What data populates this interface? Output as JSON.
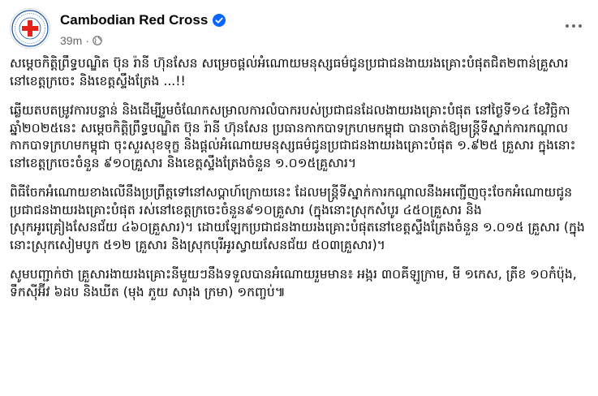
{
  "post": {
    "author": "Cambodian Red Cross",
    "time": "39m",
    "separator": "·",
    "paragraphs": [
      "សម្ដេចកិត្តិព្រឹទ្ធបណ្ឌិត ប៊ុន រ៉ានី ហ៊ុនសែន សម្រេចផ្ដល់អំណោយមនុស្សធម៌ជូនប្រជាជនងាយរងគ្រោះបំផុតជិត២ពាន់គ្រួសារ នៅខេត្តក្រចេះ និងខេត្តស្ទឹងត្រែង ...!!",
      "ឆ្លើយតបតម្រូវការបន្ទាន់ និងដើម្បីរួមចំណែកសម្រាលការលំបាករបស់ប្រជាជនដែលងាយរងគ្រោះបំផុត នៅថ្ងៃទី១៤ ខែវិច្ឆិកា ឆ្នាំ២០២៥នេះ សម្ដេចកិត្តិព្រឹទ្ធបណ្ឌិត ប៊ុន រ៉ានី ហ៊ុនសែន ប្រធានកាកបាទក្រហមកម្ពុជា បានចាត់ឱ្យមន្ត្រីទីស្នាក់ការកណ្ដាលកាកបាទក្រហមកម្ពុជា ចុះសួរសុខទុក្ខ និងផ្ដល់អំណោយមនុស្សធម៌ជូនប្រជាជនងាយរងគ្រោះបំផុត ១.៩២៥ គ្រួសារ ក្នុងនោះនៅខេត្តក្រចេះចំនួន ៩១០គ្រួសារ និងខេត្តស្ទឹងត្រែងចំនួន ១.០១៥គ្រួសារ។",
      "ពិធីចែកអំណោយខាងលើនឹងប្រព្រឹត្តទៅនៅសប្ដាហ៍ក្រោយនេះ ដែលមន្ត្រីទីស្នាក់ការកណ្ដាលនឹងអញ្ជើញចុះចែកអំណោយជូនប្រជាជនងាយរងគ្រោះបំផុត រស់នៅខេត្តក្រចេះចំនួន៩១០គ្រួសារ (ក្នុងនោះស្រុកសំបូរ ៤៥០គ្រួសារ និងស្រុកអូរគ្រៀងសែនជ័យ ៤៦០គ្រួសារ)។ ដោយឡែកប្រជាជនងាយរងគ្រោះបំផុតនៅខេត្តស្ទឹងត្រែងចំនួន ១.០១៥ គ្រួសារ (ក្នុងនោះស្រុកសៀមបូក ៥១២ គ្រួសារ និងស្រុកបុរីអូរស្វាយសែនជ័យ ៥០៣គ្រួសារ)។",
      "សូមបញ្ជាក់ថា គ្រួសារងាយរងគ្រោះនីមួយៗនឹងទទួលបានអំណោយរួមមាន៖ អង្ករ ៣០គីឡូក្រាម, មី ១កេស, ត្រីខ ១០កំប៉ុង, ទឹកស៊ីអ៊ីវ ៦ដប និងឃីត (មុង ភួយ សារុង ក្រមា) ១កញ្ចប់៕"
    ]
  },
  "icons": {
    "verified": "verified-badge-icon",
    "audience": "globe-icon",
    "more": "more-options-icon",
    "logo": "red-cross-logo"
  },
  "colors": {
    "verified_blue": "#0866ff",
    "red_cross": "#e32219",
    "muted_text": "#65676b",
    "text": "#050505"
  }
}
